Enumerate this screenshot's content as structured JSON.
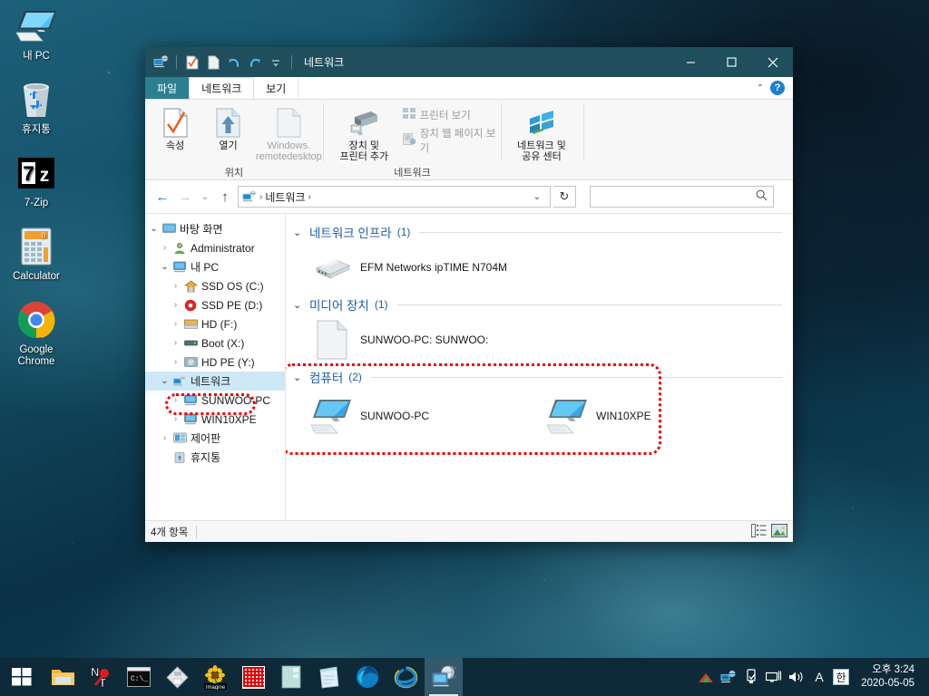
{
  "desktop": {
    "icons": [
      {
        "name": "my-pc",
        "label": "내 PC",
        "icon": "computer-icon"
      },
      {
        "name": "recycle-bin",
        "label": "휴지통",
        "icon": "recycle-bin-icon"
      },
      {
        "name": "7zip",
        "label": "7-Zip",
        "icon": "7zip-icon"
      },
      {
        "name": "calculator",
        "label": "Calculator",
        "icon": "calculator-icon"
      },
      {
        "name": "google-chrome",
        "label": "Google\nChrome",
        "icon": "chrome-icon"
      }
    ]
  },
  "explorer": {
    "title": "네트워크",
    "quick_access": [
      "network-icon",
      "properties-icon",
      "new-folder-icon",
      "undo-icon",
      "redo-icon",
      "customize-dropdown-icon"
    ],
    "window_controls": {
      "minimize": "–",
      "maximize": "▢",
      "close": "✕"
    },
    "tabs": [
      {
        "label": "파일",
        "type": "file"
      },
      {
        "label": "네트워크",
        "type": "active"
      },
      {
        "label": "보기",
        "type": "normal"
      }
    ],
    "ribbon": {
      "groups": [
        {
          "title": "위치",
          "buttons": [
            {
              "label": "속성",
              "icon": "properties-page-icon",
              "enabled": true
            },
            {
              "label": "열기",
              "icon": "open-page-icon",
              "enabled": true
            },
            {
              "label": "Windows.\nremotedesktop",
              "icon": "blank-page-icon",
              "enabled": false
            }
          ]
        },
        {
          "title": "네트워크",
          "buttons": [
            {
              "label": "장치 및\n프린터 추가",
              "icon": "printer-add-icon",
              "enabled": true
            }
          ],
          "small_buttons": [
            {
              "label": "프린터 보기",
              "icon": "view-printers-icon"
            },
            {
              "label": "장치 웹 페이지 보기",
              "icon": "device-webpage-icon"
            }
          ]
        },
        {
          "title": "",
          "buttons": [
            {
              "label": "네트워크 및\n공유 센터",
              "icon": "network-sharing-center-icon",
              "enabled": true
            }
          ]
        }
      ]
    },
    "addressbar": {
      "back": "←",
      "forward": "→",
      "recent": "⌄",
      "up": "↑",
      "crumb_icon": "network-icon",
      "crumbs": [
        "네트워크"
      ],
      "dropdown": "⌄",
      "refresh": "↻",
      "search_placeholder": "",
      "search_value": "",
      "search_icon": "search-icon"
    },
    "navpane": [
      {
        "label": "바탕 화면",
        "icon": "desktop-icon",
        "indent": 0,
        "twisty": "open",
        "selected": false
      },
      {
        "label": "Administrator",
        "icon": "user-icon",
        "indent": 1,
        "twisty": "closed",
        "selected": false
      },
      {
        "label": "내 PC",
        "icon": "computer-icon",
        "indent": 1,
        "twisty": "open",
        "selected": false
      },
      {
        "label": "SSD OS (C:)",
        "icon": "drive-system-icon",
        "indent": 2,
        "twisty": "closed",
        "selected": false
      },
      {
        "label": "SSD PE (D:)",
        "icon": "disc-icon",
        "indent": 2,
        "twisty": "closed",
        "selected": false
      },
      {
        "label": "HD (F:)",
        "icon": "drive-icon",
        "indent": 2,
        "twisty": "closed",
        "selected": false
      },
      {
        "label": "Boot (X:)",
        "icon": "drive-dark-icon",
        "indent": 2,
        "twisty": "closed",
        "selected": false
      },
      {
        "label": "HD PE (Y:)",
        "icon": "drive-blue-icon",
        "indent": 2,
        "twisty": "closed",
        "selected": false
      },
      {
        "label": "네트워크",
        "icon": "network-icon",
        "indent": 1,
        "twisty": "open",
        "selected": true
      },
      {
        "label": "SUNWOO-PC",
        "icon": "computer-icon",
        "indent": 2,
        "twisty": "closed",
        "selected": false
      },
      {
        "label": "WIN10XPE",
        "icon": "computer-icon",
        "indent": 2,
        "twisty": "closed",
        "selected": false
      },
      {
        "label": "제어판",
        "icon": "control-panel-icon",
        "indent": 1,
        "twisty": "closed",
        "selected": false
      },
      {
        "label": "휴지통",
        "icon": "recycle-bin-small-icon",
        "indent": 1,
        "twisty": "none",
        "selected": false
      }
    ],
    "content_groups": [
      {
        "name": "네트워크 인프라",
        "count": "(1)",
        "items": [
          {
            "label": "EFM Networks ipTIME N704M",
            "icon": "router-icon"
          }
        ]
      },
      {
        "name": "미디어 장치",
        "count": "(1)",
        "items": [
          {
            "label": "SUNWOO-PC: SUNWOO:",
            "icon": "generic-file-icon"
          }
        ]
      },
      {
        "name": "컴퓨터",
        "count": "(2)",
        "highlighted": true,
        "items": [
          {
            "label": "SUNWOO-PC",
            "icon": "pc-monitor-icon"
          },
          {
            "label": "WIN10XPE",
            "icon": "pc-monitor-icon"
          }
        ]
      }
    ],
    "statusbar": {
      "item_count": "4개 항목",
      "view_buttons": [
        "details-view-icon",
        "large-icons-view-icon"
      ]
    }
  },
  "taskbar": {
    "start_icon": "windows-start-icon",
    "items": [
      {
        "name": "file-explorer",
        "icon": "folder-icon",
        "active": false
      },
      {
        "name": "nt-password-tool",
        "icon": "nt-key-icon",
        "active": false
      },
      {
        "name": "command-prompt",
        "icon": "console-icon",
        "active": false
      },
      {
        "name": "disk-tool",
        "icon": "floppy-icon",
        "active": false
      },
      {
        "name": "imagine-viewer",
        "icon": "sunflower-icon",
        "active": false
      },
      {
        "name": "grid-app",
        "icon": "red-grid-icon",
        "active": false
      },
      {
        "name": "notes-app",
        "icon": "green-note-icon",
        "active": false
      },
      {
        "name": "notepad-app",
        "icon": "notepad-icon",
        "active": false
      },
      {
        "name": "microsoft-edge",
        "icon": "edge-icon",
        "active": false
      },
      {
        "name": "internet-explorer",
        "icon": "ie-icon",
        "active": false
      },
      {
        "name": "network-explorer",
        "icon": "network-window-icon",
        "active": true
      }
    ],
    "tray": [
      {
        "name": "nvidia-tray-icon",
        "icon": "red-triangle-icon"
      },
      {
        "name": "network-tray-icon",
        "icon": "network-blue-icon"
      },
      {
        "name": "usb-eject-icon",
        "icon": "usb-icon"
      },
      {
        "name": "display-tray-icon",
        "icon": "monitor-icon"
      },
      {
        "name": "volume-icon",
        "icon": "speaker-icon"
      },
      {
        "name": "ime-latin-icon",
        "icon": "letter-a-icon"
      },
      {
        "name": "ime-korean-icon",
        "icon": "hangul-icon"
      }
    ],
    "clock": {
      "time": "오후 3:24",
      "date": "2020-05-05"
    }
  },
  "colors": {
    "titlebar": "#1f4e5c",
    "file_tab": "#2b7f90",
    "accent_blue": "#1a5ea8",
    "selection": "#cde8f7",
    "highlight_dashed": "#ee0000",
    "taskbar": "#0e2a38"
  }
}
